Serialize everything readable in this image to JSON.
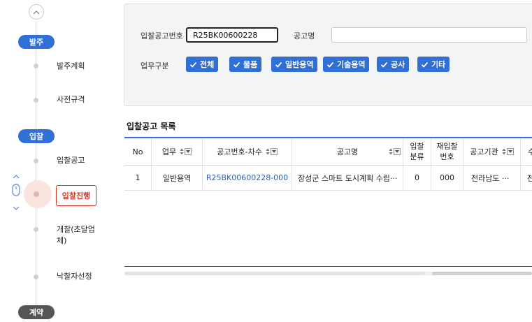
{
  "process": {
    "stages": [
      {
        "label": "발주"
      },
      {
        "label": "입찰"
      },
      {
        "label": "계약"
      }
    ],
    "steps": [
      {
        "label": "발주계획"
      },
      {
        "label": "사전규격"
      },
      {
        "label": "입찰공고"
      },
      {
        "label": "입찰진행"
      },
      {
        "label": "개찰(초달업체)"
      },
      {
        "label": "낙찰자선정"
      }
    ],
    "active_step": "입찰진행"
  },
  "search": {
    "bid_no_label": "입찰공고번호",
    "bid_no_value": "R25BK00600228",
    "bid_name_label": "공고명",
    "bid_name_value": "",
    "category_label": "업무구분",
    "categories": [
      {
        "label": "전체",
        "checked": true
      },
      {
        "label": "물품",
        "checked": true
      },
      {
        "label": "일반용역",
        "checked": true
      },
      {
        "label": "기술용역",
        "checked": true
      },
      {
        "label": "공사",
        "checked": true
      },
      {
        "label": "기타",
        "checked": true
      }
    ]
  },
  "grid": {
    "title": "입찰공고 목록",
    "columns": [
      "No",
      "업무",
      "공고번호-차수",
      "공고명",
      "입찰\n분류",
      "재입찰\n번호",
      "공고기관",
      "수"
    ],
    "rows": [
      {
        "no": "1",
        "work": "일반용역",
        "bid_no": "R25BK00600228-000",
        "name": "장성군 스마트 도시계획 수립···",
        "bid_class": "0",
        "rebid_no": "000",
        "agency": "전라남도 ···",
        "extra": "전"
      }
    ]
  },
  "colors": {
    "accent": "#2f6fd6",
    "active": "#d23a2a"
  }
}
